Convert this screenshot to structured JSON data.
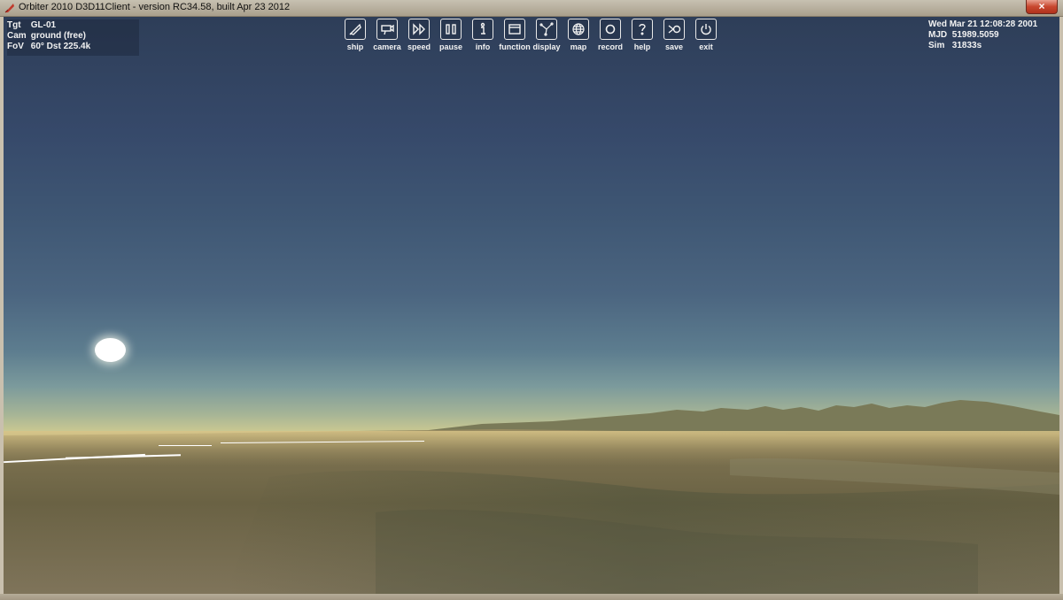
{
  "window": {
    "title": "Orbiter 2010 D3D11Client - version RC34.58, built Apr 23 2012",
    "close_glyph": "×"
  },
  "hud_left": {
    "rows": [
      {
        "key": "Tgt",
        "value": "GL-01"
      },
      {
        "key": "Cam",
        "value": "ground (free)"
      },
      {
        "key": "FoV",
        "value": "60°   Dst 225.4k"
      }
    ]
  },
  "hud_right": {
    "date": "Wed Mar 21 12:08:28 2001",
    "mjd_label": "MJD",
    "mjd_value": "51989.5059",
    "sim_label": "Sim",
    "sim_value": "31833s"
  },
  "toolbar": [
    {
      "label": "ship",
      "icon": "ship-icon"
    },
    {
      "label": "camera",
      "icon": "camera-icon"
    },
    {
      "label": "speed",
      "icon": "fast-forward-icon"
    },
    {
      "label": "pause",
      "icon": "pause-icon"
    },
    {
      "label": "info",
      "icon": "info-icon"
    },
    {
      "label": "function",
      "icon": "window-icon"
    },
    {
      "label": "display",
      "icon": "display-icon"
    },
    {
      "label": "map",
      "icon": "globe-icon"
    },
    {
      "label": "record",
      "icon": "record-icon"
    },
    {
      "label": "help",
      "icon": "help-icon"
    },
    {
      "label": "save",
      "icon": "save-icon"
    },
    {
      "label": "exit",
      "icon": "power-icon"
    }
  ],
  "colors": {
    "sky_top": "#2e3e58",
    "horizon_glow": "#f9e4a0",
    "ground": "#6b6346",
    "hud_text": "#f2f2f2"
  }
}
